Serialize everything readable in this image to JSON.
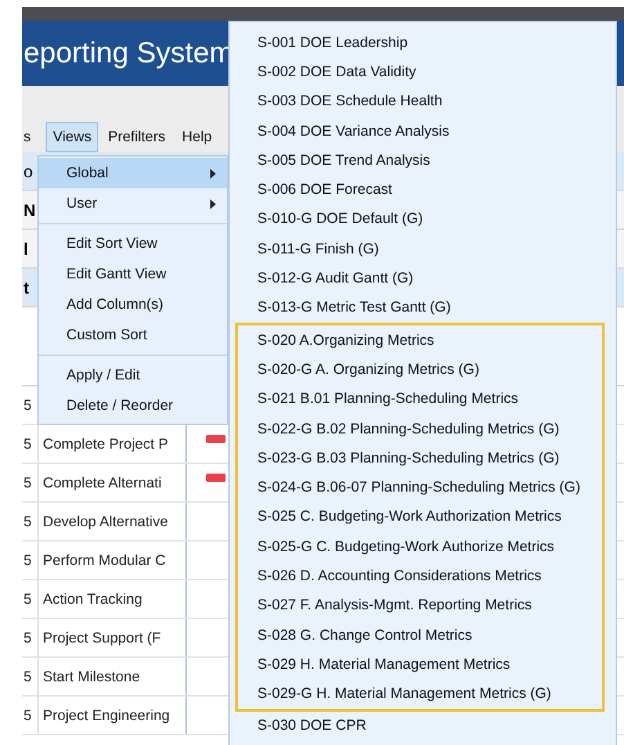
{
  "header": {
    "title": "eporting System"
  },
  "menu_bar": [
    {
      "label": "s",
      "selected": false
    },
    {
      "label": "Views",
      "selected": true
    },
    {
      "label": "Prefilters",
      "selected": false
    },
    {
      "label": "Help",
      "selected": false
    }
  ],
  "toolbar_fragment": "o",
  "grid_fragments": [
    {
      "text": "N"
    },
    {
      "text": "l"
    },
    {
      "text": "t"
    }
  ],
  "rows": [
    {
      "col_1": "5",
      "bar": false
    },
    {
      "col_1": "5",
      "col_2": "Complete Project P",
      "bar": true
    },
    {
      "col_1": "5",
      "col_2": "Complete Alternati",
      "bar": true
    },
    {
      "col_1": "5",
      "col_2": "Develop Alternative",
      "bar": false
    },
    {
      "col_1": "5",
      "col_2": "Perform Modular C",
      "bar": false
    },
    {
      "col_1": "5",
      "col_2": "Action Tracking",
      "bar": false
    },
    {
      "col_1": "5",
      "col_2": "Project Support (F",
      "bar": false
    },
    {
      "col_1": "5",
      "col_2": "Start Milestone",
      "bar": false
    },
    {
      "col_1": "5",
      "col_2": "Project Engineering",
      "bar": false
    }
  ],
  "views_menu": {
    "groups": [
      [
        {
          "label": "Global",
          "selected": true,
          "submenu": true
        },
        {
          "label": "User",
          "selected": false,
          "submenu": true
        }
      ],
      [
        {
          "label": "Edit Sort View",
          "selected": false,
          "submenu": false
        },
        {
          "label": "Edit Gantt View",
          "selected": false,
          "submenu": false
        },
        {
          "label": "Add Column(s)",
          "selected": false,
          "submenu": false
        },
        {
          "label": "Custom Sort",
          "selected": false,
          "submenu": false
        }
      ],
      [
        {
          "label": "Apply / Edit",
          "selected": false,
          "submenu": false
        },
        {
          "label": "Delete / Reorder",
          "selected": false,
          "submenu": false
        }
      ]
    ]
  },
  "global_submenu": {
    "items_before": [
      "S-001 DOE Leadership",
      "S-002 DOE Data Validity",
      "S-003 DOE Schedule Health",
      "S-004 DOE Variance Analysis",
      "S-005 DOE Trend Analysis",
      "S-006 DOE Forecast",
      "S-010-G DOE Default (G)",
      "S-011-G Finish (G)",
      "S-012-G Audit Gantt (G)",
      "S-013-G Metric Test Gantt (G)"
    ],
    "highlighted_items": [
      "S-020 A.Organizing Metrics",
      "S-020-G A. Organizing Metrics (G)",
      "S-021 B.01 Planning-Scheduling Metrics",
      "S-022-G B.02 Planning-Scheduling Metrics (G)",
      "S-023-G B.03 Planning-Scheduling Metrics (G)",
      "S-024-G B.06-07 Planning-Scheduling Metrics (G)",
      "S-025 C. Budgeting-Work Authorization Metrics",
      "S-025-G C. Budgeting-Work Authorize Metrics",
      "S-026 D. Accounting Considerations Metrics",
      "S-027 F. Analysis-Mgmt. Reporting Metrics",
      "S-028 G. Change Control Metrics",
      "S-029 H. Material Management Metrics",
      "S-029-G H. Material Management Metrics (G)"
    ],
    "items_after": [
      "S-030 DOE CPR"
    ]
  }
}
